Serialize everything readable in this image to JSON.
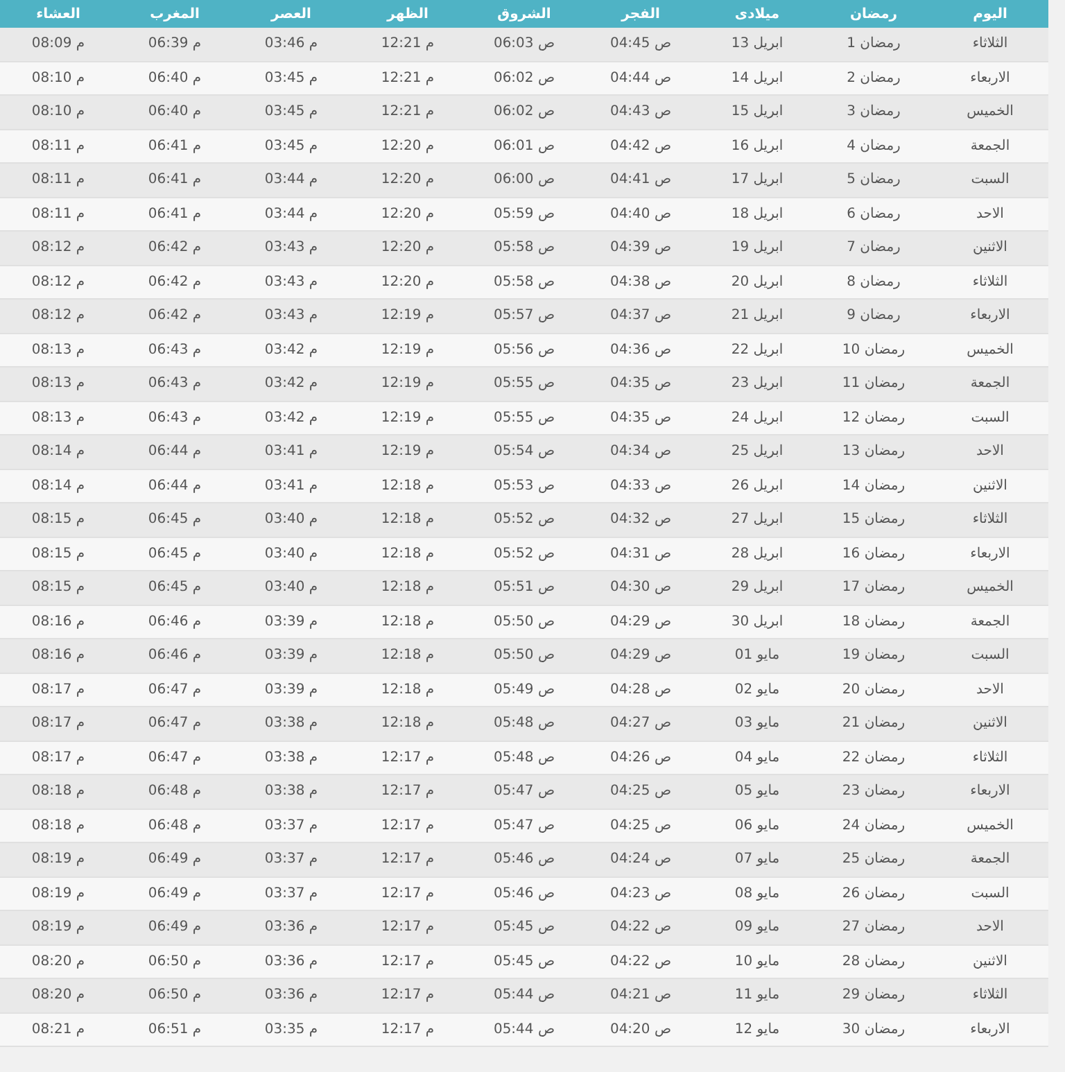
{
  "table": {
    "columns": [
      "اليوم",
      "رمضان",
      "ميلادى",
      "الفجر",
      "الشروق",
      "الظهر",
      "العصر",
      "المغرب",
      "العشاء"
    ],
    "rows": [
      [
        "الثلاثاء",
        "1 رمضان",
        "13 ابريل",
        "04:45 ص",
        "06:03 ص",
        "12:21 م",
        "03:46 م",
        "06:39 م",
        "08:09 م"
      ],
      [
        "الاربعاء",
        "2 رمضان",
        "14 ابريل",
        "04:44 ص",
        "06:02 ص",
        "12:21 م",
        "03:45 م",
        "06:40 م",
        "08:10 م"
      ],
      [
        "الخميس",
        "3 رمضان",
        "15 ابريل",
        "04:43 ص",
        "06:02 ص",
        "12:21 م",
        "03:45 م",
        "06:40 م",
        "08:10 م"
      ],
      [
        "الجمعة",
        "4 رمضان",
        "16 ابريل",
        "04:42 ص",
        "06:01 ص",
        "12:20 م",
        "03:45 م",
        "06:41 م",
        "08:11 م"
      ],
      [
        "السبت",
        "5 رمضان",
        "17 ابريل",
        "04:41 ص",
        "06:00 ص",
        "12:20 م",
        "03:44 م",
        "06:41 م",
        "08:11 م"
      ],
      [
        "الاحد",
        "6 رمضان",
        "18 ابريل",
        "04:40 ص",
        "05:59 ص",
        "12:20 م",
        "03:44 م",
        "06:41 م",
        "08:11 م"
      ],
      [
        "الاثنين",
        "7 رمضان",
        "19 ابريل",
        "04:39 ص",
        "05:58 ص",
        "12:20 م",
        "03:43 م",
        "06:42 م",
        "08:12 م"
      ],
      [
        "الثلاثاء",
        "8 رمضان",
        "20 ابريل",
        "04:38 ص",
        "05:58 ص",
        "12:20 م",
        "03:43 م",
        "06:42 م",
        "08:12 م"
      ],
      [
        "الاربعاء",
        "9 رمضان",
        "21 ابريل",
        "04:37 ص",
        "05:57 ص",
        "12:19 م",
        "03:43 م",
        "06:42 م",
        "08:12 م"
      ],
      [
        "الخميس",
        "10 رمضان",
        "22 ابريل",
        "04:36 ص",
        "05:56 ص",
        "12:19 م",
        "03:42 م",
        "06:43 م",
        "08:13 م"
      ],
      [
        "الجمعة",
        "11 رمضان",
        "23 ابريل",
        "04:35 ص",
        "05:55 ص",
        "12:19 م",
        "03:42 م",
        "06:43 م",
        "08:13 م"
      ],
      [
        "السبت",
        "12 رمضان",
        "24 ابريل",
        "04:35 ص",
        "05:55 ص",
        "12:19 م",
        "03:42 م",
        "06:43 م",
        "08:13 م"
      ],
      [
        "الاحد",
        "13 رمضان",
        "25 ابريل",
        "04:34 ص",
        "05:54 ص",
        "12:19 م",
        "03:41 م",
        "06:44 م",
        "08:14 م"
      ],
      [
        "الاثنين",
        "14 رمضان",
        "26 ابريل",
        "04:33 ص",
        "05:53 ص",
        "12:18 م",
        "03:41 م",
        "06:44 م",
        "08:14 م"
      ],
      [
        "الثلاثاء",
        "15 رمضان",
        "27 ابريل",
        "04:32 ص",
        "05:52 ص",
        "12:18 م",
        "03:40 م",
        "06:45 م",
        "08:15 م"
      ],
      [
        "الاربعاء",
        "16 رمضان",
        "28 ابريل",
        "04:31 ص",
        "05:52 ص",
        "12:18 م",
        "03:40 م",
        "06:45 م",
        "08:15 م"
      ],
      [
        "الخميس",
        "17 رمضان",
        "29 ابريل",
        "04:30 ص",
        "05:51 ص",
        "12:18 م",
        "03:40 م",
        "06:45 م",
        "08:15 م"
      ],
      [
        "الجمعة",
        "18 رمضان",
        "30 ابريل",
        "04:29 ص",
        "05:50 ص",
        "12:18 م",
        "03:39 م",
        "06:46 م",
        "08:16 م"
      ],
      [
        "السبت",
        "19 رمضان",
        "01 مايو",
        "04:29 ص",
        "05:50 ص",
        "12:18 م",
        "03:39 م",
        "06:46 م",
        "08:16 م"
      ],
      [
        "الاحد",
        "20 رمضان",
        "02 مايو",
        "04:28 ص",
        "05:49 ص",
        "12:18 م",
        "03:39 م",
        "06:47 م",
        "08:17 م"
      ],
      [
        "الاثنين",
        "21 رمضان",
        "03 مايو",
        "04:27 ص",
        "05:48 ص",
        "12:18 م",
        "03:38 م",
        "06:47 م",
        "08:17 م"
      ],
      [
        "الثلاثاء",
        "22 رمضان",
        "04 مايو",
        "04:26 ص",
        "05:48 ص",
        "12:17 م",
        "03:38 م",
        "06:47 م",
        "08:17 م"
      ],
      [
        "الاربعاء",
        "23 رمضان",
        "05 مايو",
        "04:25 ص",
        "05:47 ص",
        "12:17 م",
        "03:38 م",
        "06:48 م",
        "08:18 م"
      ],
      [
        "الخميس",
        "24 رمضان",
        "06 مايو",
        "04:25 ص",
        "05:47 ص",
        "12:17 م",
        "03:37 م",
        "06:48 م",
        "08:18 م"
      ],
      [
        "الجمعة",
        "25 رمضان",
        "07 مايو",
        "04:24 ص",
        "05:46 ص",
        "12:17 م",
        "03:37 م",
        "06:49 م",
        "08:19 م"
      ],
      [
        "السبت",
        "26 رمضان",
        "08 مايو",
        "04:23 ص",
        "05:46 ص",
        "12:17 م",
        "03:37 م",
        "06:49 م",
        "08:19 م"
      ],
      [
        "الاحد",
        "27 رمضان",
        "09 مايو",
        "04:22 ص",
        "05:45 ص",
        "12:17 م",
        "03:36 م",
        "06:49 م",
        "08:19 م"
      ],
      [
        "الاثنين",
        "28 رمضان",
        "10 مايو",
        "04:22 ص",
        "05:45 ص",
        "12:17 م",
        "03:36 م",
        "06:50 م",
        "08:20 م"
      ],
      [
        "الثلاثاء",
        "29 رمضان",
        "11 مايو",
        "04:21 ص",
        "05:44 ص",
        "12:17 م",
        "03:36 م",
        "06:50 م",
        "08:20 م"
      ],
      [
        "الاربعاء",
        "30 رمضان",
        "12 مايو",
        "04:20 ص",
        "05:44 ص",
        "12:17 م",
        "03:35 م",
        "06:51 م",
        "08:21 م"
      ]
    ]
  }
}
